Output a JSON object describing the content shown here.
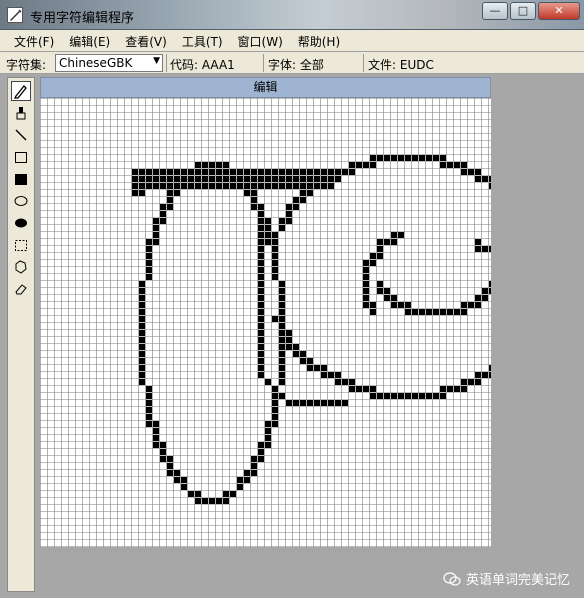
{
  "window": {
    "title": "专用字符编辑程序",
    "buttons": {
      "minimize": "—",
      "maximize": "□",
      "close": "✕"
    }
  },
  "menu": [
    {
      "label": "文件(F)"
    },
    {
      "label": "编辑(E)"
    },
    {
      "label": "查看(V)"
    },
    {
      "label": "工具(T)"
    },
    {
      "label": "窗口(W)"
    },
    {
      "label": "帮助(H)"
    }
  ],
  "toolbar": {
    "charset_label": "字符集:",
    "charset_value": "ChineseGBK",
    "code": "代码: AAA1",
    "font": "字体: 全部",
    "file": "文件: EUDC"
  },
  "tools": [
    {
      "name": "pencil-icon",
      "active": true
    },
    {
      "name": "brush-icon"
    },
    {
      "name": "line-icon"
    },
    {
      "name": "hollow-rectangle-icon"
    },
    {
      "name": "filled-rectangle-icon"
    },
    {
      "name": "hollow-ellipse-icon"
    },
    {
      "name": "filled-ellipse-icon"
    },
    {
      "name": "rect-select-icon"
    },
    {
      "name": "freeform-select-icon"
    },
    {
      "name": "eraser-icon"
    }
  ],
  "editor": {
    "header": "编辑"
  },
  "watermark": {
    "text": "英语单词完美记忆"
  },
  "colors": {
    "grid_line": "#7f7f7f",
    "pixel_on": "#000000",
    "header_bg": "#9fb4d0"
  }
}
